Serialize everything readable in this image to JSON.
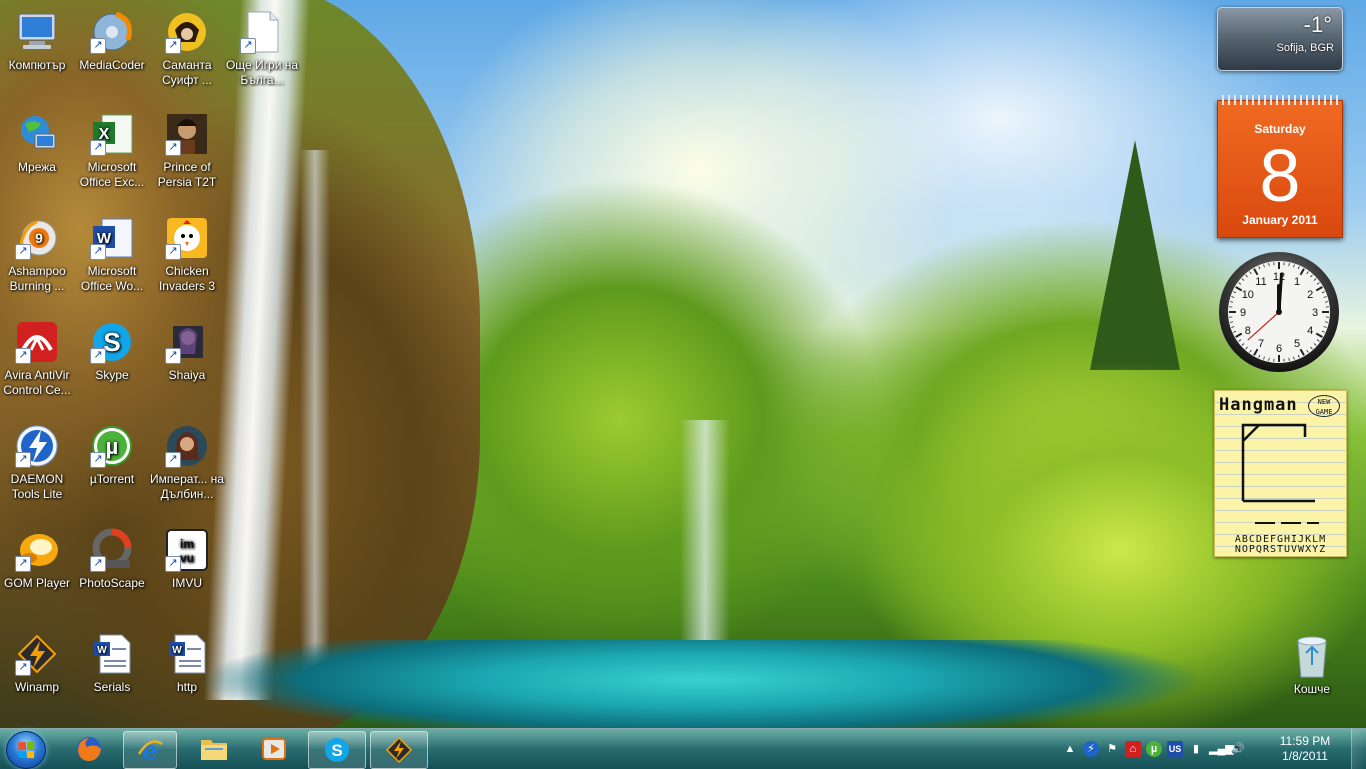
{
  "desktop": {
    "icons": [
      {
        "label": "Компютър",
        "icon": "computer-icon"
      },
      {
        "label": "MediaCoder",
        "icon": "mediacoder-icon"
      },
      {
        "label": "Саманта Суифт ...",
        "icon": "samantha-swift-game-icon"
      },
      {
        "label": "Още Игри на Бълга...",
        "icon": "blank-document-icon"
      },
      {
        "label": "Мрежа",
        "icon": "network-icon"
      },
      {
        "label": "Microsoft Office Exc...",
        "icon": "excel-icon"
      },
      {
        "label": "Prince of Persia T2T",
        "icon": "prince-of-persia-icon"
      },
      {
        "label": "Ashampoo Burning ...",
        "icon": "ashampoo-icon"
      },
      {
        "label": "Microsoft Office Wo...",
        "icon": "word-icon"
      },
      {
        "label": "Chicken Invaders 3",
        "icon": "chicken-invaders-icon"
      },
      {
        "label": "Avira AntiVir Control Ce...",
        "icon": "avira-icon"
      },
      {
        "label": "Skype",
        "icon": "skype-icon"
      },
      {
        "label": "Shaiya",
        "icon": "shaiya-icon"
      },
      {
        "label": "DAEMON Tools Lite",
        "icon": "daemon-tools-icon"
      },
      {
        "label": "µTorrent",
        "icon": "utorrent-icon"
      },
      {
        "label": "Императ... на Дълбин...",
        "icon": "empire-game-icon"
      },
      {
        "label": "GOM Player",
        "icon": "gom-player-icon"
      },
      {
        "label": "PhotoScape",
        "icon": "photoscape-icon"
      },
      {
        "label": "IMVU",
        "icon": "imvu-icon"
      },
      {
        "label": "Winamp",
        "icon": "winamp-icon"
      },
      {
        "label": "Serials",
        "icon": "word-document-icon"
      },
      {
        "label": "http",
        "icon": "word-document-icon"
      }
    ],
    "recycle_bin": {
      "label": "Кошче",
      "icon": "recycle-bin-icon"
    }
  },
  "gadgets": {
    "weather": {
      "temperature": "-1°",
      "city": "Sofija, BGR"
    },
    "calendar": {
      "weekday": "Saturday",
      "day": "8",
      "month_year": "January 2011"
    },
    "clock": {
      "hour": 12,
      "minute": 0,
      "second": 38,
      "numerals": [
        "12",
        "1",
        "2",
        "3",
        "4",
        "5",
        "6",
        "7",
        "8",
        "9",
        "10",
        "11"
      ]
    },
    "hangman": {
      "title": "Hangman",
      "new_game": "NEW GAME",
      "letters_row1": "ABCDEFGHIJKLM",
      "letters_row2": "NOPQRSTUVWXYZ"
    }
  },
  "taskbar": {
    "pinned": [
      {
        "name": "firefox",
        "icon": "firefox-icon",
        "active": false
      },
      {
        "name": "internet-explorer",
        "icon": "internet-explorer-icon",
        "active": true
      },
      {
        "name": "windows-explorer",
        "icon": "folder-icon",
        "active": false
      },
      {
        "name": "media-player",
        "icon": "media-player-icon",
        "active": false
      },
      {
        "name": "skype",
        "icon": "skype-icon",
        "active": true
      },
      {
        "name": "winamp",
        "icon": "winamp-icon",
        "active": true
      }
    ],
    "tray": {
      "language": "US",
      "time": "11:59 PM",
      "date": "1/8/2011"
    }
  },
  "colors": {
    "calendar_orange": "#e55a18",
    "taskbar_teal": "#2a7c86",
    "start_orb_blue": "#2a7ad6"
  }
}
